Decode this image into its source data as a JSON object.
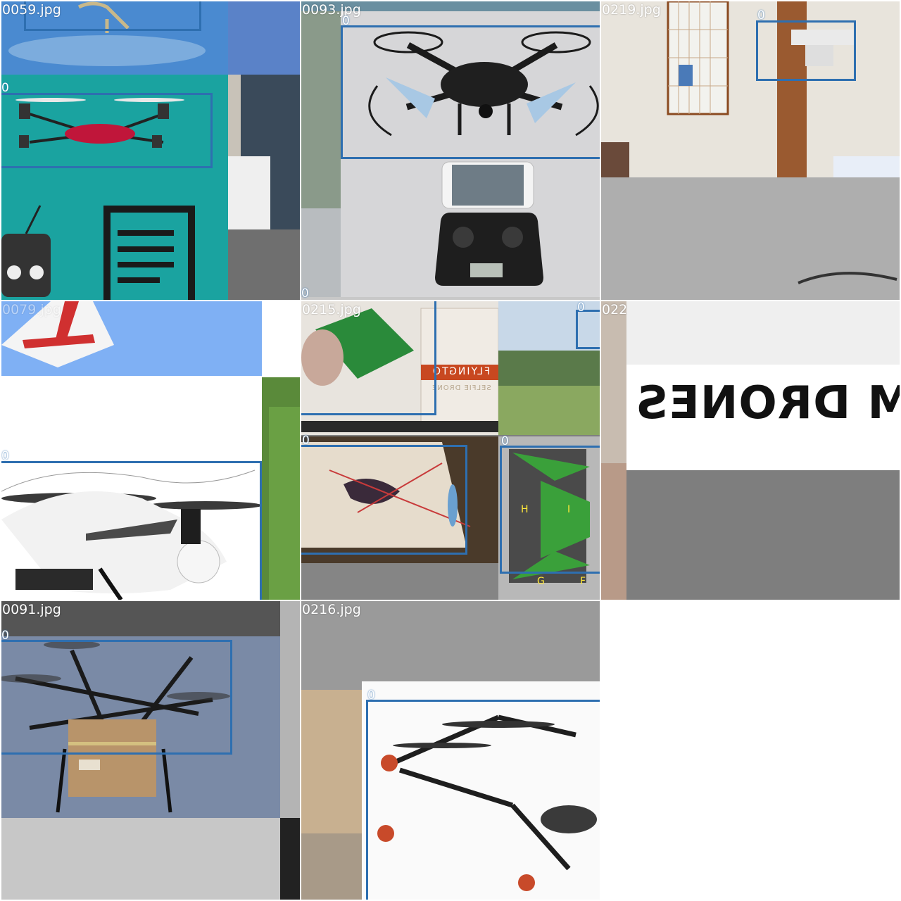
{
  "grid": {
    "background": "#ffffff",
    "box_color": "#2e6fb0",
    "tiles": [
      {
        "filename": "0059.jpg",
        "labels": [
          "0"
        ]
      },
      {
        "filename": "0093.jpg",
        "labels": [
          "0",
          "0"
        ]
      },
      {
        "filename": "0219.jpg",
        "labels": [
          "0"
        ]
      },
      {
        "filename": "0079.jpg",
        "labels": [
          "0"
        ]
      },
      {
        "filename": "0215.jpg",
        "labels": [
          "0",
          "0",
          "0"
        ]
      },
      {
        "filename": "022",
        "labels": []
      },
      {
        "filename": "0091.jpg",
        "labels": [
          "0"
        ]
      },
      {
        "filename": "0216.jpg",
        "labels": [
          "0"
        ]
      }
    ]
  },
  "overlays": {
    "custom_drones_text": "CUSTOM DRONES",
    "box_text_flyington": "FLYINGTO",
    "box_text_selfie": "SELFIE DRONE",
    "hud_letters": [
      "H",
      "I",
      "G",
      "F"
    ]
  }
}
